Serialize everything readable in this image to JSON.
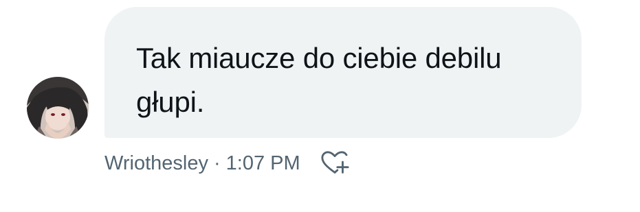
{
  "message": {
    "text": "Tak miaucze do ciebie debilu głupi.",
    "sender": "Wriothesley",
    "separator": "·",
    "time": "1:07 PM"
  },
  "icons": {
    "avatar": "profile-avatar",
    "react": "heart-plus-icon"
  },
  "colors": {
    "bubble": "#eff3f4",
    "text": "#0f1419",
    "meta": "#536471"
  }
}
